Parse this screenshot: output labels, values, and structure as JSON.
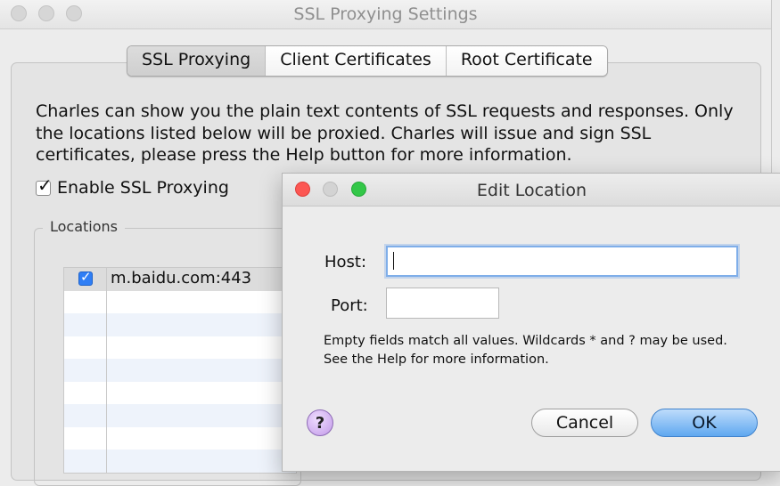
{
  "window": {
    "title": "SSL Proxying Settings",
    "tabs": [
      {
        "label": "SSL Proxying",
        "active": true
      },
      {
        "label": "Client Certificates",
        "active": false
      },
      {
        "label": "Root Certificate",
        "active": false
      }
    ],
    "description": "Charles can show you the plain text contents of SSL requests and responses. Only the locations listed below will be proxied. Charles will issue and sign SSL certificates, please press the Help button for more information.",
    "enable_ssl_label": "Enable SSL Proxying",
    "enable_ssl_checked": true,
    "locations_label": "Locations",
    "locations": [
      {
        "checked": true,
        "host": "m.baidu.com:443"
      }
    ]
  },
  "dialog": {
    "title": "Edit Location",
    "host_label": "Host:",
    "host_value": "",
    "port_label": "Port:",
    "port_value": "",
    "hint": "Empty fields match all values. Wildcards * and ? may be used. See the Help for more information.",
    "help_label": "?",
    "cancel_label": "Cancel",
    "ok_label": "OK"
  },
  "colors": {
    "accent_blue": "#5fa8f0",
    "close_red": "#fc5753",
    "minimize_gray": "#d3d3d3",
    "zoom_green": "#33c748",
    "help_purple": "#c29ae8"
  }
}
